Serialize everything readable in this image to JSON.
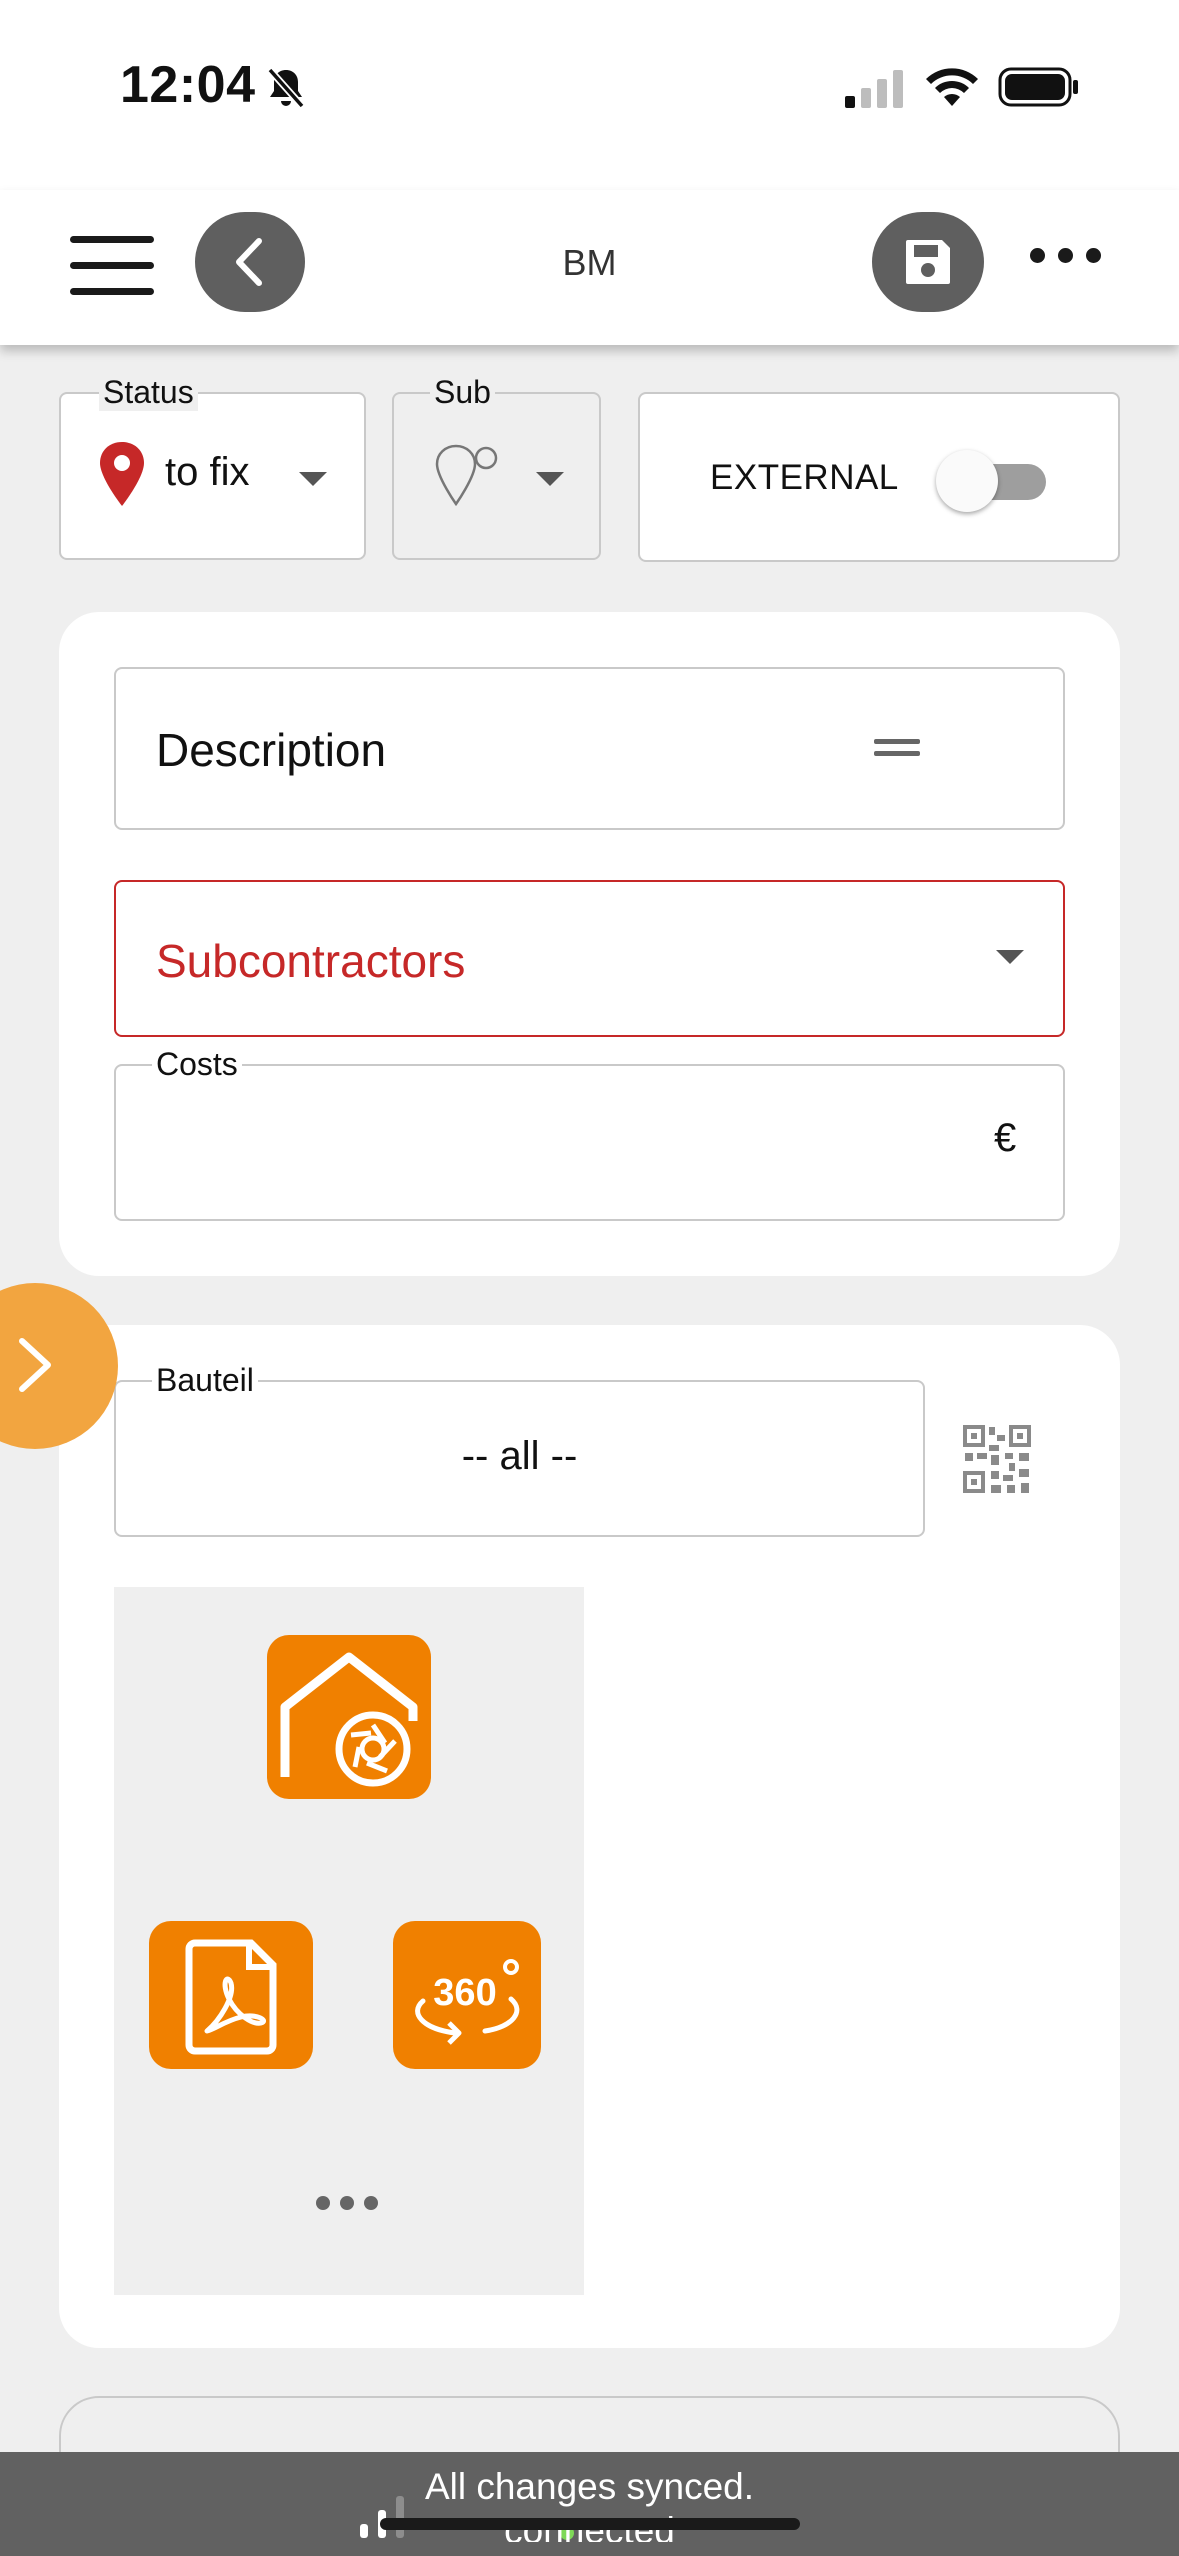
{
  "statusbar": {
    "time": "12:04"
  },
  "header": {
    "title": "BM"
  },
  "status": {
    "label": "Status",
    "value": "to fix",
    "pin_color": "#c62828"
  },
  "sub": {
    "label": "Sub"
  },
  "external": {
    "label": "EXTERNAL",
    "enabled": false
  },
  "form": {
    "description_placeholder": "Description",
    "subcontractors_placeholder": "Subcontractors",
    "costs_label": "Costs",
    "currency_symbol": "€"
  },
  "component": {
    "label": "Bauteil",
    "value": "-- all --"
  },
  "media": {
    "buttons": [
      "camera-house-icon",
      "pdf-icon",
      "360-icon"
    ],
    "accent_color": "#f08000"
  },
  "sync": {
    "message": "All changes synced.",
    "connection": "connected"
  },
  "colors": {
    "error": "#c62828",
    "accent": "#f08000",
    "side_button": "#f2a540",
    "dark_button": "#5f5f5f"
  }
}
